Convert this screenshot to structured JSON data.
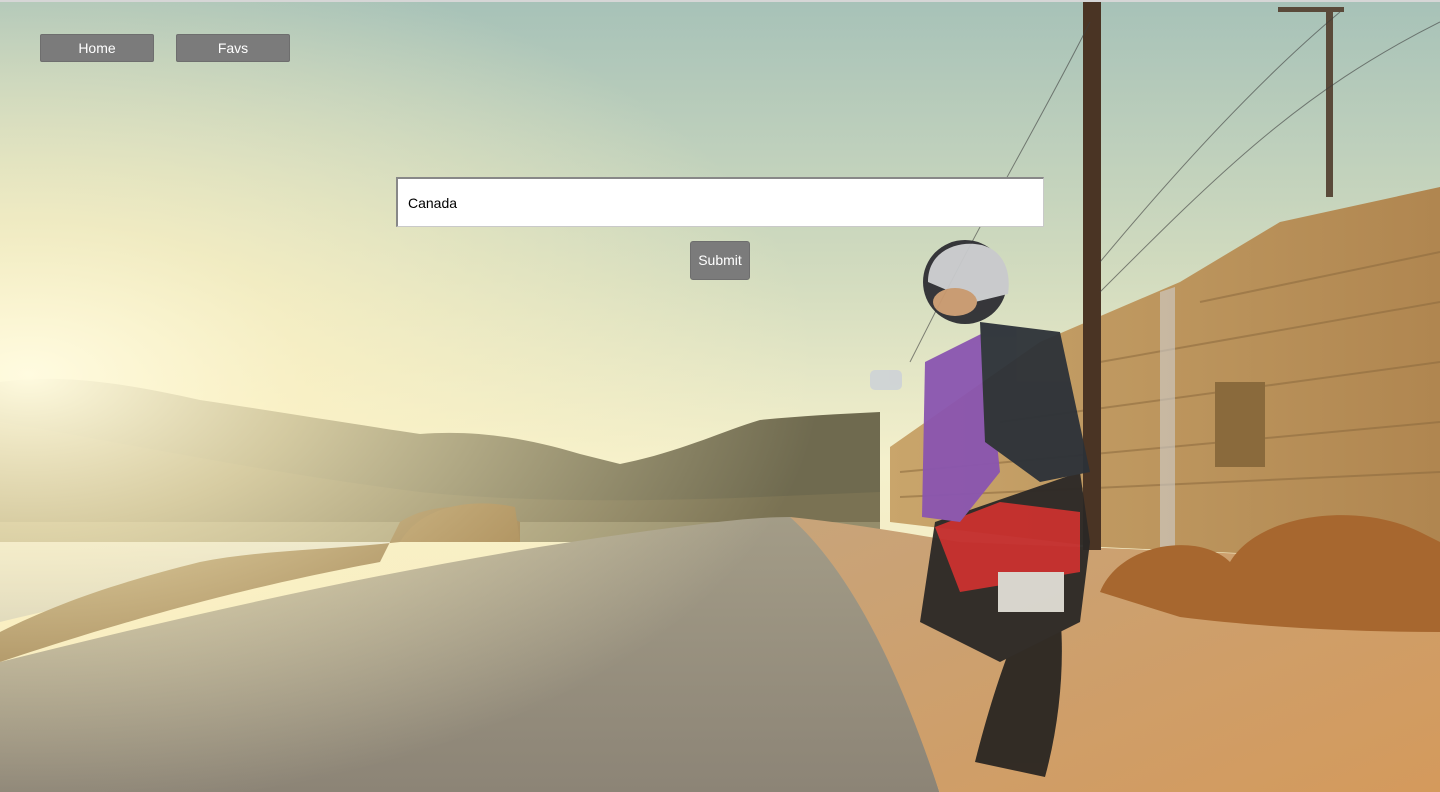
{
  "nav": {
    "home_label": "Home",
    "favs_label": "Favs"
  },
  "search": {
    "value": "Canada"
  },
  "submit_label": "Submit",
  "background": {
    "description_icon": "photo-background"
  }
}
